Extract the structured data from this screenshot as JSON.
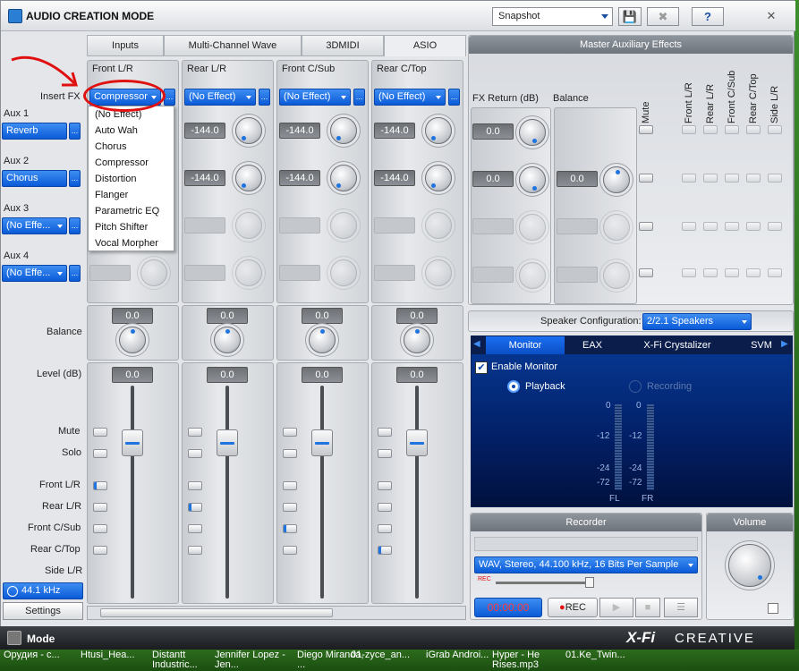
{
  "window": {
    "title": "AUDIO CREATION MODE",
    "snapshot": "Snapshot",
    "save_label": "💾",
    "close_snapshot_label": "✖",
    "help_label": "?",
    "close_label": "✕"
  },
  "tabs": [
    "Inputs",
    "Multi-Channel Wave",
    "3DMIDI",
    "ASIO"
  ],
  "left_labels": {
    "insert_fx": "Insert FX",
    "aux1": "Aux 1",
    "aux1_value": "Reverb",
    "aux2": "Aux 2",
    "aux2_value": "Chorus",
    "aux3": "Aux 3",
    "aux3_value": "(No Effe...",
    "aux4": "Aux 4",
    "aux4_value": "(No Effe...",
    "balance": "Balance",
    "level": "Level (dB)",
    "mute": "Mute",
    "solo": "Solo",
    "front_lr": "Front L/R",
    "rear_lr": "Rear L/R",
    "front_csub": "Front C/Sub",
    "rear_ctop": "Rear C/Top",
    "side_lr": "Side L/R",
    "sample_rate": "44.1 kHz",
    "settings": "Settings"
  },
  "strips": [
    {
      "name": "Front L/R",
      "fx": "Compressor",
      "aux1": "",
      "aux2": "",
      "balance": "0.0",
      "level": "0.0"
    },
    {
      "name": "Rear L/R",
      "fx": "(No Effect)",
      "aux1": "-144.0",
      "aux2": "-144.0",
      "balance": "0.0",
      "level": "0.0"
    },
    {
      "name": "Front C/Sub",
      "fx": "(No Effect)",
      "aux1": "-144.0",
      "aux2": "-144.0",
      "balance": "0.0",
      "level": "0.0"
    },
    {
      "name": "Rear C/Top",
      "fx": "(No Effect)",
      "aux1": "-144.0",
      "aux2": "-144.0",
      "balance": "0.0",
      "level": "0.0"
    }
  ],
  "fx_menu": [
    "(No Effect)",
    "Auto Wah",
    "Chorus",
    "Compressor",
    "Distortion",
    "Flanger",
    "Parametric EQ",
    "Pitch Shifter",
    "Vocal Morpher"
  ],
  "master_aux": {
    "title": "Master Auxiliary Effects",
    "fx_return": "FX Return (dB)",
    "balance": "Balance",
    "value1": "0.0",
    "value2": "0.0",
    "value3": "0.0",
    "columns": [
      "Mute",
      "Front L/R",
      "Rear L/R",
      "Front C/Sub",
      "Rear C/Top",
      "Side L/R"
    ]
  },
  "speaker": {
    "label": "Speaker Configuration:",
    "value": "2/2.1 Speakers"
  },
  "monitor": {
    "tabs": [
      "Monitor",
      "EAX",
      "X-Fi Crystalizer",
      "SVM"
    ],
    "enable": "Enable Monitor",
    "playback": "Playback",
    "recording": "Recording",
    "scale": [
      "0",
      "-12",
      "-24",
      "-72"
    ],
    "fl": "FL",
    "fr": "FR"
  },
  "recorder": {
    "title": "Recorder",
    "format": "WAV, Stereo, 44.100 kHz, 16 Bits Per Sample",
    "time": "00:00:00",
    "rec": "REC",
    "rec_small": "REC"
  },
  "volume": {
    "title": "Volume"
  },
  "footer": {
    "mode": "Mode",
    "brand": "CREATIVE",
    "logo": "X-Fi"
  },
  "taskbar": [
    "Орудия - с...",
    "Htusi_Hea...",
    "Distantt Industric...",
    "Jennifer Lopez - Jen...",
    "Diego Miranda, ...",
    "01-zyce_an...",
    "iGrab Androi...",
    "Hyper - He Rises.mp3",
    "01.Ke_Twin..."
  ],
  "colors": {
    "accent": "#1f74e0",
    "annotation": "#e01010"
  }
}
